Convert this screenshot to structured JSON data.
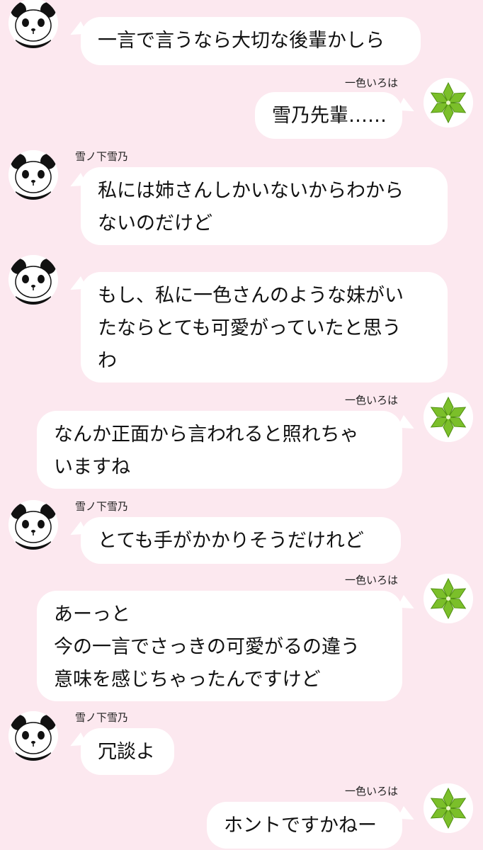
{
  "colors": {
    "background": "#fce8ef",
    "bubble": "#ffffff",
    "text": "#111111",
    "leaf_green": "#7bbf2a"
  },
  "icons": {
    "panda_avatar": "panda-icon",
    "leaf_avatar": "green-star-leaf-icon"
  },
  "messages": [
    {
      "side": "left",
      "sender": "",
      "lines": [
        "一言で言うなら大切な後輩かしら"
      ]
    },
    {
      "side": "right",
      "sender": "一色いろは",
      "lines": [
        "雪乃先輩……"
      ]
    },
    {
      "side": "left",
      "sender": "雪ノ下雪乃",
      "lines": [
        "私には姉さんしかいないからわから",
        "ないのだけど"
      ]
    },
    {
      "side": "left",
      "sender": "",
      "lines": [
        "もし、私に一色さんのような妹がい",
        "たならとても可愛がっていたと思う",
        "わ"
      ]
    },
    {
      "side": "right",
      "sender": "一色いろは",
      "lines": [
        "なんか正面から言われると照れちゃ",
        "いますね"
      ]
    },
    {
      "side": "left",
      "sender": "雪ノ下雪乃",
      "lines": [
        "とても手がかかりそうだけれど"
      ]
    },
    {
      "side": "right",
      "sender": "一色いろは",
      "lines": [
        "あーっと",
        "今の一言でさっきの可愛がるの違う",
        "意味を感じちゃったんですけど"
      ]
    },
    {
      "side": "left",
      "sender": "雪ノ下雪乃",
      "lines": [
        "冗談よ"
      ]
    },
    {
      "side": "right",
      "sender": "一色いろは",
      "lines": [
        "ホントですかねー"
      ]
    }
  ]
}
